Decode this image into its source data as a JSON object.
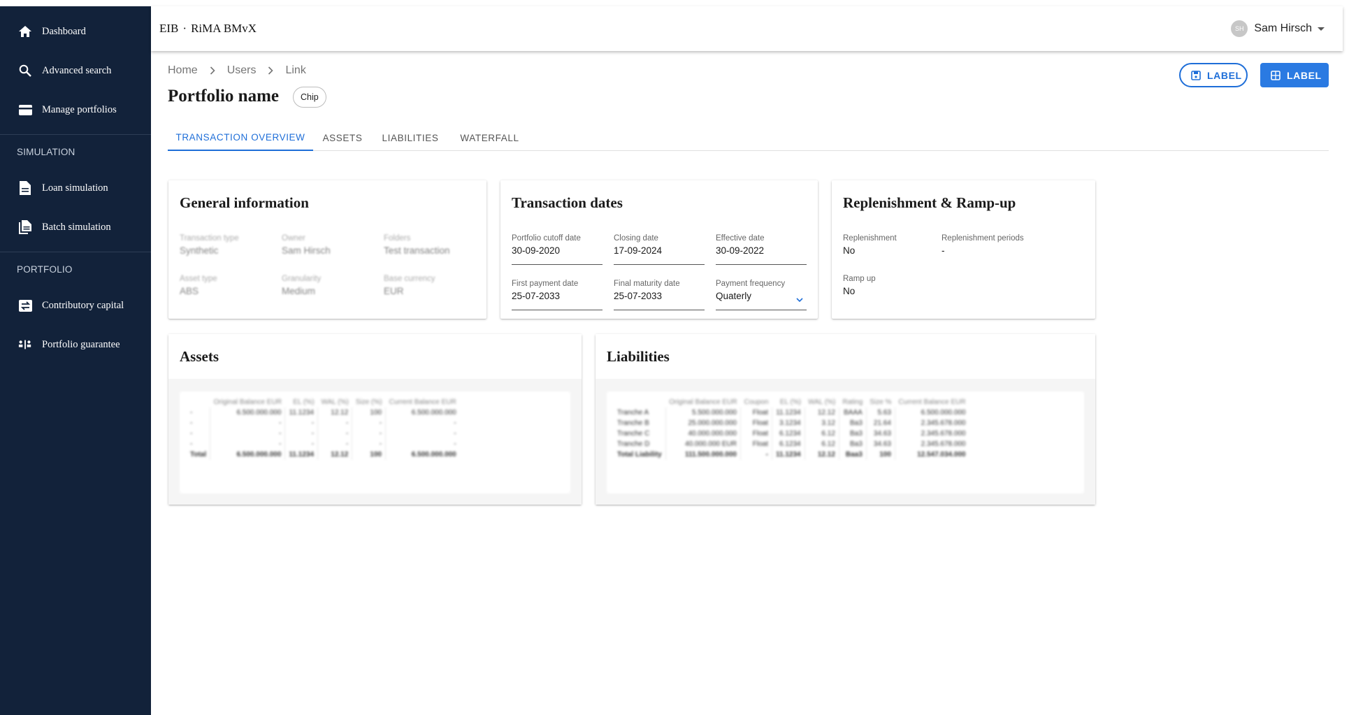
{
  "sidebar": {
    "items": [
      {
        "label": "Dashboard",
        "icon": "home-icon"
      },
      {
        "label": "Advanced search",
        "icon": "search-icon"
      },
      {
        "label": "Manage portfolios",
        "icon": "wallet-icon"
      },
      {
        "label": "Loan simulation",
        "icon": "document-icon"
      },
      {
        "label": "Batch simulation",
        "icon": "documents-icon"
      },
      {
        "label": "Contributory capital",
        "icon": "swap-icon"
      },
      {
        "label": "Portfolio guarantee",
        "icon": "balance-icon"
      }
    ],
    "sections": [
      "SIMULATION",
      "PORTFOLIO"
    ]
  },
  "appbar": {
    "org": "EIB",
    "app": "RiMA BMvX",
    "user_initials": "SH",
    "user_name": "Sam Hirsch"
  },
  "breadcrumb": [
    "Home",
    "Users",
    "Link"
  ],
  "page": {
    "title": "Portfolio name",
    "chip": "Chip"
  },
  "actions": {
    "outlined_label": "LABEL",
    "contained_label": "LABEL"
  },
  "tabs": [
    "TRANSACTION OVERVIEW",
    "ASSETS",
    "LIABILITIES",
    "WATERFALL"
  ],
  "general_information": {
    "title": "General information",
    "fields": [
      {
        "label": "Transaction type",
        "value": "Synthetic"
      },
      {
        "label": "Owner",
        "value": "Sam Hirsch"
      },
      {
        "label": "Folders",
        "value": "Test transaction"
      },
      {
        "label": "Asset type",
        "value": "ABS"
      },
      {
        "label": "Granularity",
        "value": "Medium"
      },
      {
        "label": "Base currency",
        "value": "EUR"
      }
    ]
  },
  "transaction_dates": {
    "title": "Transaction dates",
    "fields": [
      {
        "label": "Portfolio cutoff date",
        "value": "30-09-2020"
      },
      {
        "label": "Closing date",
        "value": "17-09-2024"
      },
      {
        "label": "Effective date",
        "value": "30-09-2022"
      },
      {
        "label": "First payment date",
        "value": "25-07-2033"
      },
      {
        "label": "Final maturity date",
        "value": "25-07-2033"
      },
      {
        "label": "Payment frequency",
        "value": "Quaterly"
      }
    ]
  },
  "replenishment": {
    "title": "Replenishment & Ramp-up",
    "fields": [
      {
        "label": "Replenishment",
        "value": "No"
      },
      {
        "label": "Replenishment periods",
        "value": "-"
      },
      {
        "label": "Ramp up",
        "value": "No"
      }
    ]
  },
  "assets": {
    "title": "Assets",
    "columns": [
      "",
      "Original Balance EUR",
      "EL (%)",
      "WAL (%)",
      "Size (%)",
      "Current Balance EUR"
    ],
    "rows": [
      [
        "-",
        "6.500.000.000",
        "11.1234",
        "12.12",
        "100",
        "6.500.000.000"
      ],
      [
        "-",
        "-",
        "-",
        "-",
        "-",
        "-"
      ],
      [
        "-",
        "-",
        "-",
        "-",
        "-",
        "-"
      ],
      [
        "-",
        "-",
        "-",
        "-",
        "-",
        "-"
      ],
      [
        "Total",
        "6.500.000.000",
        "11.1234",
        "12.12",
        "100",
        "6.500.000.000"
      ]
    ]
  },
  "liabilities": {
    "title": "Liabilities",
    "columns": [
      "",
      "Original Balance EUR",
      "Coupon",
      "EL (%)",
      "WAL (%)",
      "Rating",
      "Size %",
      "Current Balance EUR"
    ],
    "rows": [
      [
        "Tranche A",
        "5.500.000.000",
        "Float",
        "11.1234",
        "12.12",
        "BAAA",
        "5.63",
        "6.500.000.000"
      ],
      [
        "Tranche B",
        "25.000.000.000",
        "Float",
        "3.1234",
        "3.12",
        "Ba3",
        "21.64",
        "2.345.678.000"
      ],
      [
        "Tranche C",
        "40.000.000.000",
        "Float",
        "6.1234",
        "6.12",
        "Ba3",
        "34.63",
        "2.345.678.000"
      ],
      [
        "Tranche D",
        "40.000.000 EUR",
        "Float",
        "6.1234",
        "6.12",
        "Ba3",
        "34.63",
        "2.345.678.000"
      ],
      [
        "Total Liability",
        "111.500.000.000",
        "-",
        "11.1234",
        "12.12",
        "Baa3",
        "100",
        "12.547.034.000"
      ]
    ]
  }
}
